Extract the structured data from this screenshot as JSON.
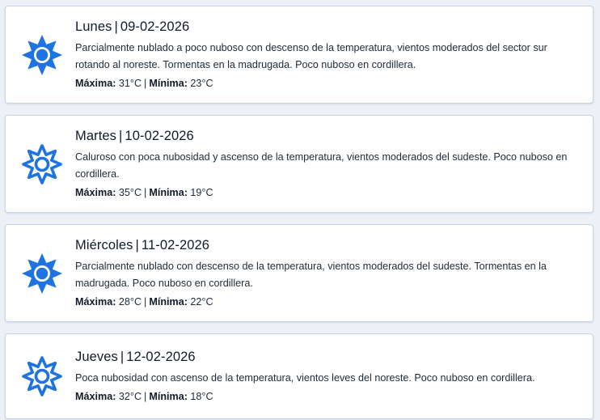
{
  "forecast": {
    "icon_color": "#1d74e0",
    "labels": {
      "max": "Máxima:",
      "min": "Mínima:"
    },
    "days": [
      {
        "day": "Lunes",
        "date": "09-02-2026",
        "icon": "sun-icon",
        "description": "Parcialmente nublado a poco nuboso con descenso de la temperatura, vientos moderados del sector sur rotando al noreste. Tormentas en la madrugada. Poco nuboso en cordillera.",
        "max": "31°C",
        "min": "23°C"
      },
      {
        "day": "Martes",
        "date": "10-02-2026",
        "icon": "sun-outline-icon",
        "description": "Caluroso con poca nubosidad y ascenso de la temperatura, vientos moderados del sudeste. Poco nuboso en cordillera.",
        "max": "35°C",
        "min": "19°C"
      },
      {
        "day": "Miércoles",
        "date": "11-02-2026",
        "icon": "sun-icon",
        "description": "Parcialmente nublado con descenso de la temperatura, vientos moderados del sudeste. Tormentas en la madrugada. Poco nuboso en cordillera.",
        "max": "28°C",
        "min": "22°C"
      },
      {
        "day": "Jueves",
        "date": "12-02-2026",
        "icon": "sun-outline-icon",
        "description": "Poca nubosidad con ascenso de la temperatura, vientos leves del noreste. Poco nuboso en cordillera.",
        "max": "32°C",
        "min": "18°C"
      }
    ]
  }
}
